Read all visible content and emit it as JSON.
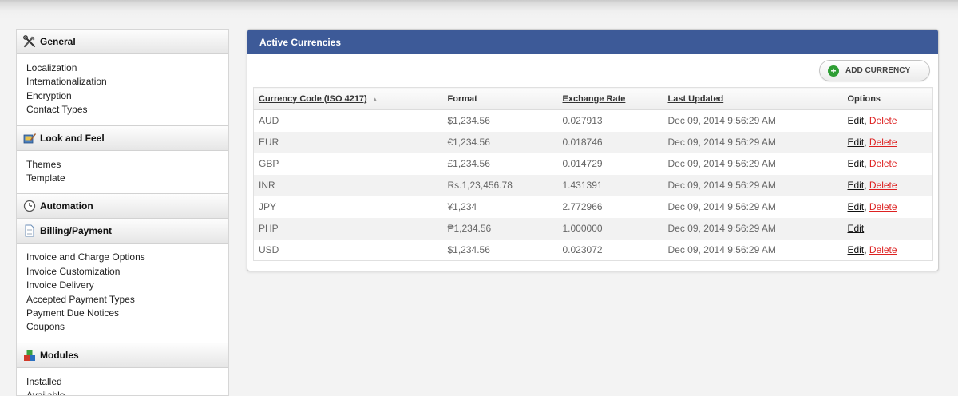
{
  "sidebar": {
    "sections": [
      {
        "title": "General",
        "icon": "tools-icon",
        "items": [
          "Localization",
          "Internationalization",
          "Encryption",
          "Contact Types"
        ]
      },
      {
        "title": "Look and Feel",
        "icon": "paint-icon",
        "items": [
          "Themes",
          "Template"
        ]
      },
      {
        "title": "Automation",
        "icon": "clock-icon",
        "items": []
      },
      {
        "title": "Billing/Payment",
        "icon": "document-icon",
        "items": [
          "Invoice and Charge Options",
          "Invoice Customization",
          "Invoice Delivery",
          "Accepted Payment Types",
          "Payment Due Notices",
          "Coupons"
        ]
      },
      {
        "title": "Modules",
        "icon": "modules-icon",
        "items": [
          "Installed",
          "Available"
        ]
      }
    ]
  },
  "panel": {
    "title": "Active Currencies",
    "add_button": "ADD CURRENCY",
    "columns": [
      "Currency Code (ISO 4217)",
      "Format",
      "Exchange Rate",
      "Last Updated",
      "Options"
    ],
    "edit_label": "Edit",
    "delete_label": "Delete",
    "rows": [
      {
        "code": "AUD",
        "format": "$1,234.56",
        "rate": "0.027913",
        "updated": "Dec 09, 2014 9:56:29 AM",
        "deletable": true
      },
      {
        "code": "EUR",
        "format": "€1,234.56",
        "rate": "0.018746",
        "updated": "Dec 09, 2014 9:56:29 AM",
        "deletable": true
      },
      {
        "code": "GBP",
        "format": "£1,234.56",
        "rate": "0.014729",
        "updated": "Dec 09, 2014 9:56:29 AM",
        "deletable": true
      },
      {
        "code": "INR",
        "format": "Rs.1,23,456.78",
        "rate": "1.431391",
        "updated": "Dec 09, 2014 9:56:29 AM",
        "deletable": true
      },
      {
        "code": "JPY",
        "format": "¥1,234",
        "rate": "2.772966",
        "updated": "Dec 09, 2014 9:56:29 AM",
        "deletable": true
      },
      {
        "code": "PHP",
        "format": "₱1,234.56",
        "rate": "1.000000",
        "updated": "Dec 09, 2014 9:56:29 AM",
        "deletable": false
      },
      {
        "code": "USD",
        "format": "$1,234.56",
        "rate": "0.023072",
        "updated": "Dec 09, 2014 9:56:29 AM",
        "deletable": true
      }
    ]
  },
  "colors": {
    "panel_header": "#3d5a98",
    "delete_link": "#dd2222",
    "add_icon": "#2e9e34"
  }
}
